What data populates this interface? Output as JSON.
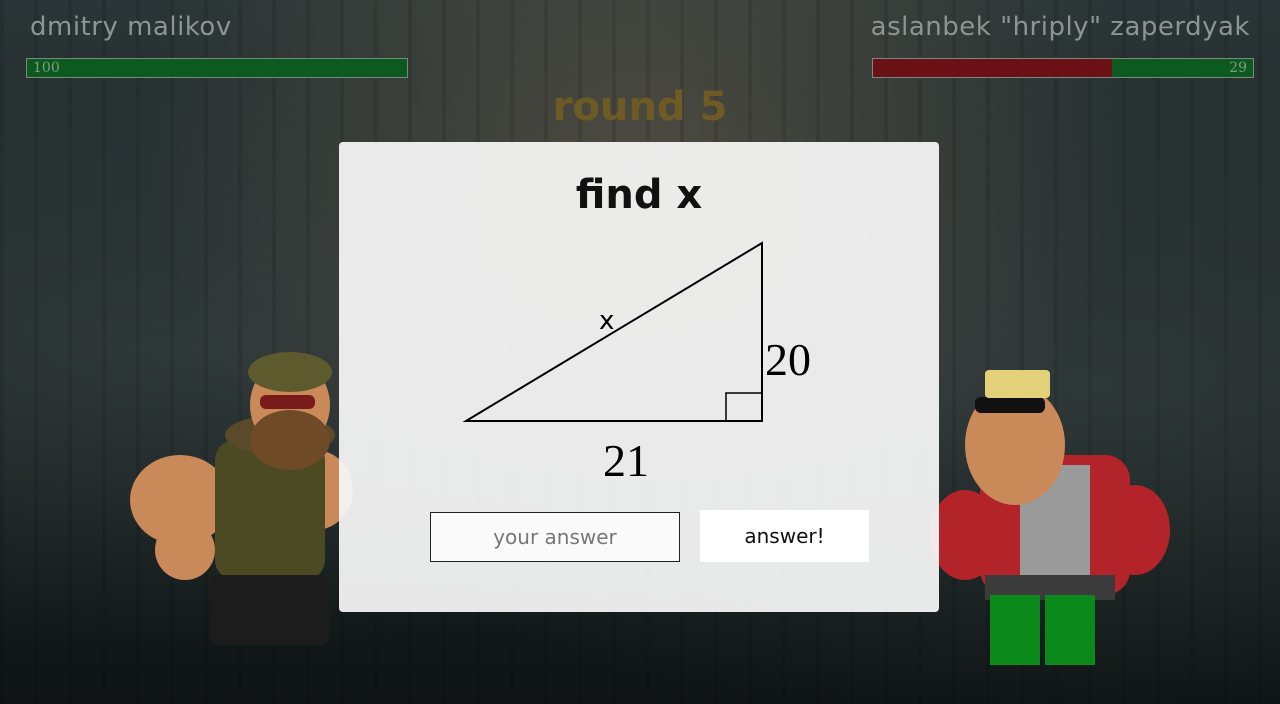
{
  "player1": {
    "name": "dmitry malikov",
    "hp": "100",
    "hp_fraction": 1.0,
    "bar_color": "#0c5a1f"
  },
  "player2": {
    "name": "aslanbek \"hriply\" zaperdyak",
    "hp": "29",
    "hp_fraction": 0.37,
    "bar_color": "#0c5a1f",
    "damage_color": "#6b1014"
  },
  "round": {
    "label": "round 5"
  },
  "modal": {
    "title": "find x",
    "diagram": {
      "hypotenuse_label": "x",
      "vertical_label": "20",
      "horizontal_label": "21"
    },
    "input_placeholder": "your answer",
    "button_label": "answer!"
  }
}
